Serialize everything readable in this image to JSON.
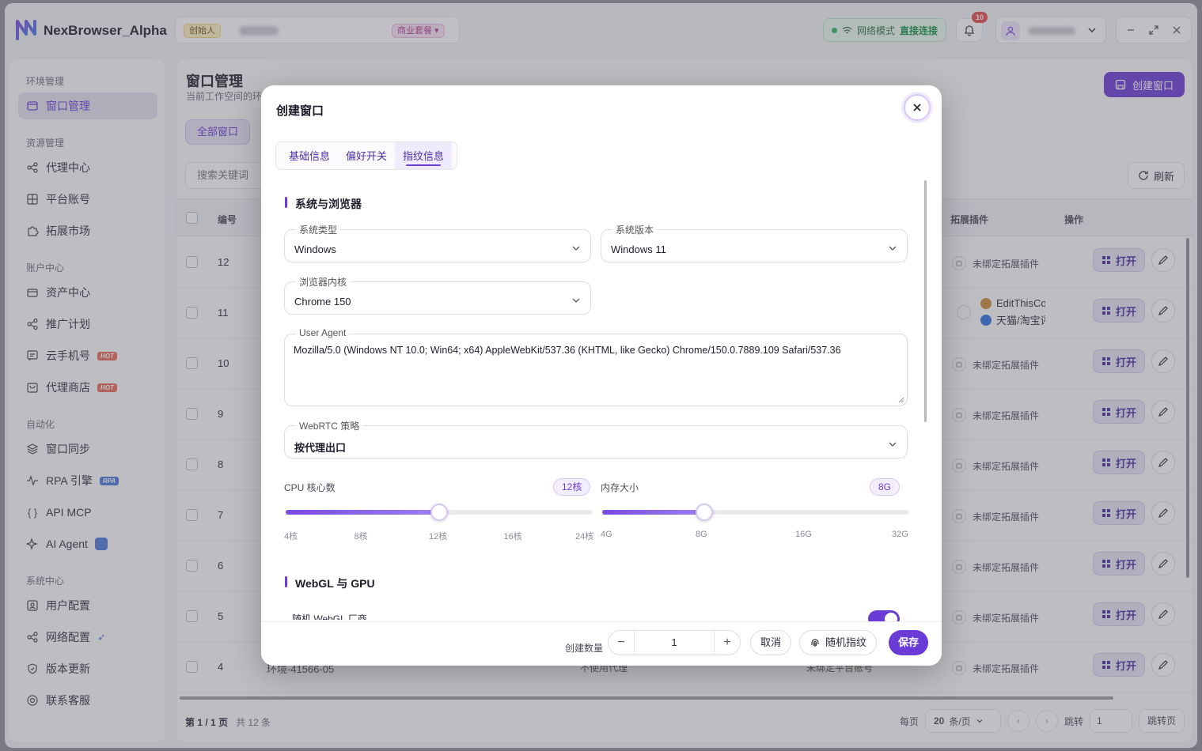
{
  "app": {
    "brand": "NexBrowser_Alpha"
  },
  "workspace": {
    "creator_badge": "创始人",
    "plan_badge": "商业套餐"
  },
  "network": {
    "label": "网络模式",
    "value": "直接连接"
  },
  "notifications": {
    "count": "10"
  },
  "sidebar": {
    "groups": [
      {
        "title": "环境管理",
        "items": [
          {
            "label": "窗口管理",
            "icon": "window-icon",
            "active": true
          }
        ]
      },
      {
        "title": "资源管理",
        "items": [
          {
            "label": "代理中心",
            "icon": "proxy-icon"
          },
          {
            "label": "平台账号",
            "icon": "grid-icon"
          },
          {
            "label": "拓展市场",
            "icon": "puzzle-icon"
          }
        ]
      },
      {
        "title": "账户中心",
        "items": [
          {
            "label": "资产中心",
            "icon": "card-icon"
          },
          {
            "label": "推广计划",
            "icon": "share-icon"
          },
          {
            "label": "云手机号",
            "icon": "message-icon",
            "badge": "HOT"
          },
          {
            "label": "代理商店",
            "icon": "store-icon",
            "badge": "HOT"
          }
        ]
      },
      {
        "title": "自动化",
        "items": [
          {
            "label": "窗口同步",
            "icon": "layers-icon"
          },
          {
            "label": "RPA 引擎",
            "icon": "pulse-icon",
            "badge": "RPA"
          },
          {
            "label": "API MCP",
            "icon": "braces-icon"
          },
          {
            "label": "AI Agent",
            "icon": "sparkle-icon"
          }
        ]
      },
      {
        "title": "系统中心",
        "items": [
          {
            "label": "用户配置",
            "icon": "user-config-icon"
          },
          {
            "label": "网络配置",
            "icon": "network-icon"
          },
          {
            "label": "版本更新",
            "icon": "shield-icon"
          },
          {
            "label": "联系客服",
            "icon": "support-icon"
          }
        ]
      }
    ]
  },
  "main": {
    "title": "窗口管理",
    "subtitle": "当前工作空间的环",
    "create_button": "创建窗口",
    "tab_all": "全部窗口",
    "search_placeholder": "搜索关键词",
    "refresh": "刷新",
    "columns": {
      "number": "编号",
      "extensions": "拓展插件",
      "actions": "操作"
    },
    "rows": [
      {
        "num": "12",
        "ext": "未绑定拓展插件"
      },
      {
        "num": "11",
        "ext1": "EditThisCoo",
        "ext2": "天猫/淘宝评"
      },
      {
        "num": "10",
        "ext": "未绑定拓展插件"
      },
      {
        "num": "9",
        "ext": "未绑定拓展插件"
      },
      {
        "num": "8",
        "ext": "未绑定拓展插件"
      },
      {
        "num": "7",
        "ext": "未绑定拓展插件"
      },
      {
        "num": "6",
        "ext": "未绑定拓展插件"
      },
      {
        "num": "5",
        "ext": "未绑定拓展插件"
      },
      {
        "num": "4",
        "ext": "未绑定拓展插件",
        "name": "环境-41566-05",
        "proxy": "不使用代理",
        "account": "未绑定平台账号"
      }
    ],
    "open_label": "打开",
    "pagination": {
      "page_prefix": "第",
      "page": "1 / 1",
      "page_suffix": "页",
      "total": "共 12 条",
      "per_page_label": "每页",
      "per_page": "20",
      "per_page_unit": "条/页",
      "jump_label": "跳转",
      "jump_value": "1",
      "jump_button": "跳转页"
    }
  },
  "modal": {
    "title": "创建窗口",
    "tabs": [
      {
        "label": "基础信息"
      },
      {
        "label": "偏好开关"
      },
      {
        "label": "指纹信息",
        "active": true
      }
    ],
    "section_system": "系统与浏览器",
    "os_type": {
      "label": "系统类型",
      "value": "Windows"
    },
    "os_version": {
      "label": "系统版本",
      "value": "Windows 11"
    },
    "kernel": {
      "label": "浏览器内核",
      "value": "Chrome 150"
    },
    "user_agent": {
      "label": "User Agent",
      "value": "Mozilla/5.0 (Windows NT 10.0; Win64; x64) AppleWebKit/537.36 (KHTML, like Gecko) Chrome/150.0.7889.109 Safari/537.36"
    },
    "webrtc": {
      "label": "WebRTC 策略",
      "value": "按代理出口"
    },
    "cpu": {
      "label": "CPU 核心数",
      "value_label": "12核",
      "value": 12,
      "ticks": [
        "4核",
        "8核",
        "12核",
        "16核",
        "24核"
      ],
      "position_fraction": 0.5
    },
    "memory": {
      "label": "内存大小",
      "value_label": "8G",
      "value": 8,
      "ticks": [
        "4G",
        "8G",
        "16G",
        "32G"
      ],
      "position_fraction": 0.333
    },
    "section_webgl": "WebGL 与 GPU",
    "webgl_vendor_label": "随机 WebGL 厂商",
    "webgl_vendor_enabled": true,
    "footer": {
      "qty_label": "创建数量",
      "qty_value": "1",
      "cancel": "取消",
      "random": "随机指纹",
      "save": "保存"
    }
  }
}
